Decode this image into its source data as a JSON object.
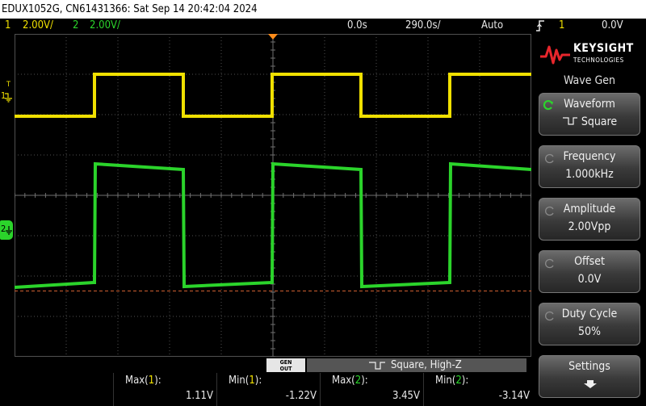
{
  "title": "EDUX1052G, CN61431366: Sat Sep 14 20:42:04 2024",
  "status": {
    "ch1_num": "1",
    "ch1_scale": "2.00V/",
    "ch2_num": "2",
    "ch2_scale": "2.00V/",
    "delay": "0.0s",
    "timebase": "290.0s/",
    "trigger_mode": "Auto",
    "trigger_ch": "1",
    "trigger_level": "0.0V"
  },
  "panel": {
    "brand": "KEYSIGHT",
    "brand_sub": "TECHNOLOGIES",
    "title": "Wave Gen",
    "softkeys": [
      {
        "label": "Waveform",
        "value": "Square"
      },
      {
        "label": "Frequency",
        "value": "1.000kHz"
      },
      {
        "label": "Amplitude",
        "value": "2.00Vpp"
      },
      {
        "label": "Offset",
        "value": "0.0V"
      },
      {
        "label": "Duty Cycle",
        "value": "50%"
      },
      {
        "label": "Settings",
        "value": ""
      }
    ]
  },
  "gen_bar": {
    "badge_top": "GEN",
    "badge_bottom": "OUT",
    "text": "Square, High-Z"
  },
  "measurements": [
    {
      "label": "Max(",
      "ch": "1",
      "close": "):",
      "value": "1.11V"
    },
    {
      "label": "Min(",
      "ch": "1",
      "close": "):",
      "value": "-1.22V"
    },
    {
      "label": "Max(",
      "ch": "2",
      "close": "):",
      "value": "3.45V"
    },
    {
      "label": "Min(",
      "ch": "2",
      "close": "):",
      "value": "-3.14V"
    }
  ],
  "markers": {
    "ch1": "1",
    "ch2": "2",
    "trig": "T"
  },
  "colors": {
    "ch1": "#f0e000",
    "ch2": "#2bd42b",
    "grid": "#505050",
    "bg": "#000000",
    "ref": "#d06030"
  },
  "icons": {
    "trigger": "trigger-edge-icon",
    "waveform_selected": "selected-cycle-icon",
    "square": "square-wave-icon",
    "settings": "down-arrow-icon"
  }
}
